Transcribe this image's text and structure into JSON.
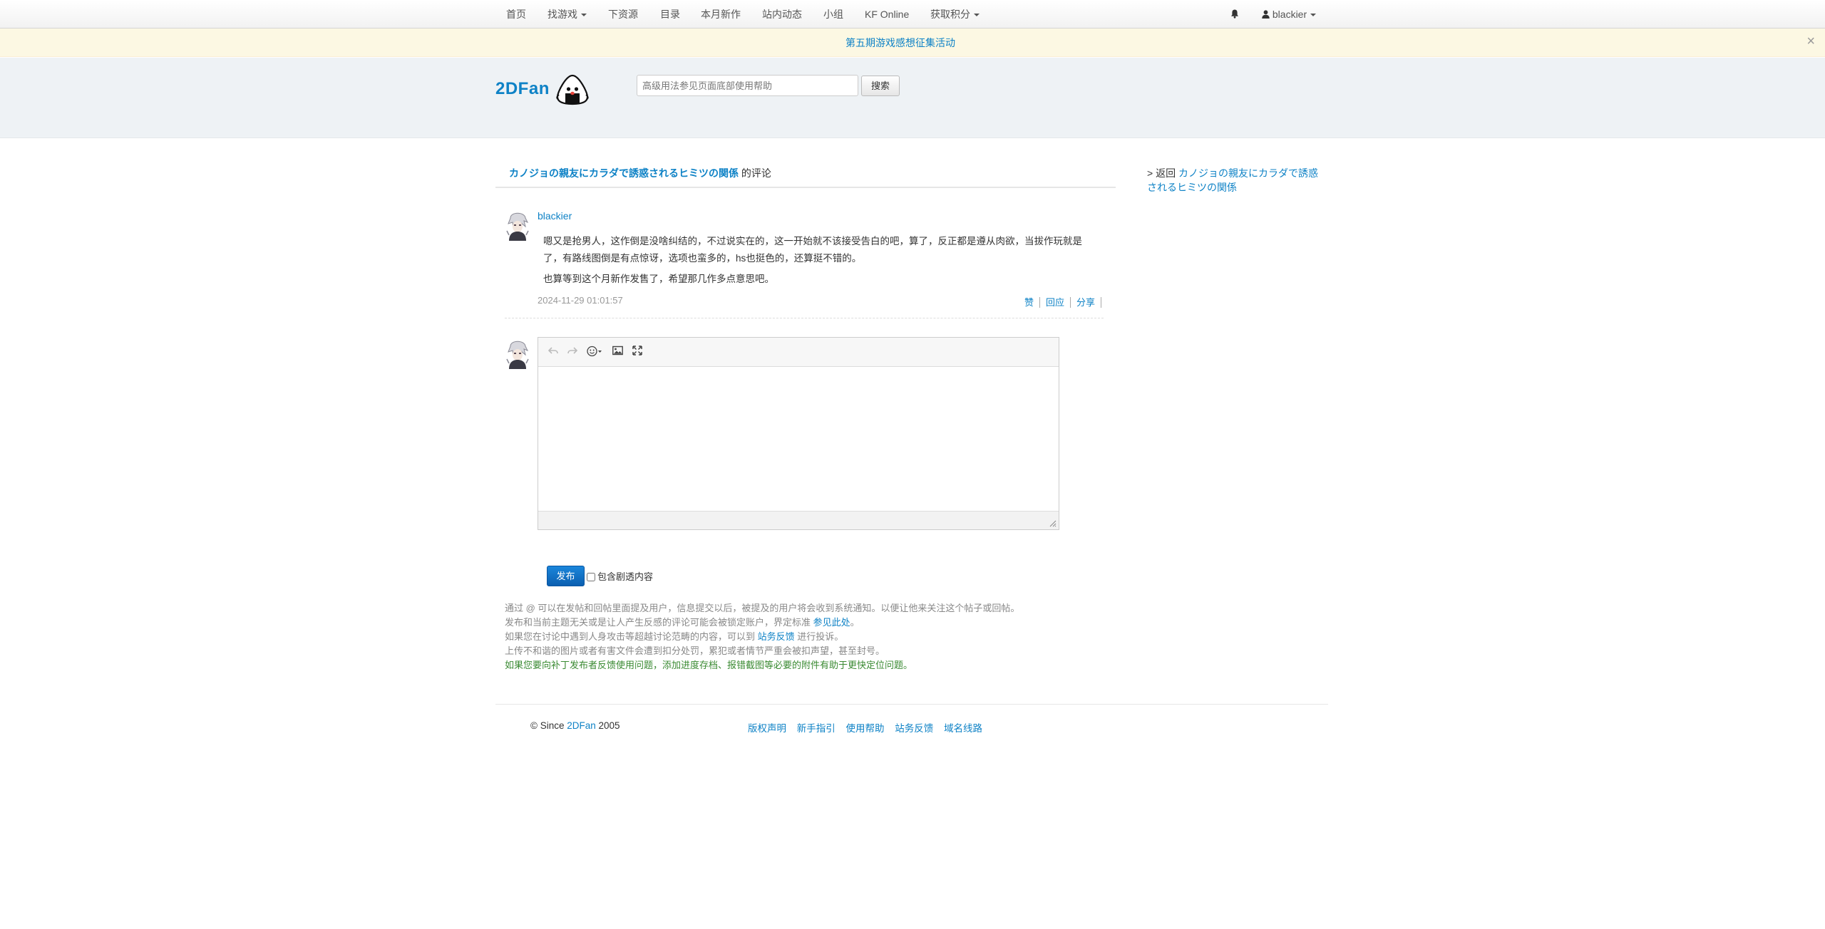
{
  "navbar": {
    "items": [
      {
        "label": "首页"
      },
      {
        "label": "找游戏"
      },
      {
        "label": "下资源"
      },
      {
        "label": "目录"
      },
      {
        "label": "本月新作"
      },
      {
        "label": "站内动态"
      },
      {
        "label": "小组"
      },
      {
        "label": "KF Online"
      },
      {
        "label": "获取积分"
      }
    ],
    "user": "blackier",
    "bell_icon": "bell-icon",
    "user_icon": "user-icon"
  },
  "announcement": {
    "text": "第五期游戏感想征集活动",
    "close": "×"
  },
  "header": {
    "logo": "2DFan",
    "search_placeholder": "高级用法参见页面底部使用帮助",
    "search_button": "搜索"
  },
  "page": {
    "title_game": "カノジョの親友にカラダで誘惑されるヒミツの関係",
    "title_suffix": " 的评论"
  },
  "comment": {
    "user": "blackier",
    "paragraphs": [
      "嗯又是抢男人，这作倒是没啥纠结的，不过说实在的，这一开始就不该接受告白的吧，算了，反正都是遵从肉欲，当拔作玩就是了，有路线图倒是有点惊讶，选项也蛮多的，hs也挺色的，还算挺不错的。",
      "也算等到这个月新作发售了，希望那几作多点意思吧。"
    ],
    "time": "2024-11-29 01:01:57",
    "actions": {
      "like": "赞",
      "reply": "回应",
      "share": "分享"
    }
  },
  "editor": {
    "icons": [
      "undo-icon",
      "redo-icon",
      "emoji-icon",
      "image-icon",
      "fullscreen-icon"
    ]
  },
  "form": {
    "publish": "发布",
    "spoiler_label": "包含剧透内容"
  },
  "notes": {
    "line1": "通过 @ 可以在发帖和回帖里面提及用户，信息提交以后，被提及的用户将会收到系统通知。以便让他来关注这个帖子或回帖。",
    "line2_pre": "发布和当前主题无关或是让人产生反感的评论可能会被锁定账户，界定标准 ",
    "line2_link": "参见此处",
    "line2_post": "。",
    "line3_pre": "如果您在讨论中遇到人身攻击等超越讨论范畴的内容，可以到 ",
    "line3_link": "站务反馈",
    "line3_post": " 进行投诉。",
    "line4": "上传不和谐的图片或者有害文件会遭到扣分处罚，累犯或者情节严重会被扣声望，甚至封号。",
    "line5": "如果您要向补丁发布者反馈使用问题，添加进度存档、报错截图等必要的附件有助于更快定位问题。"
  },
  "footer": {
    "copy_pre": "© Since ",
    "copy_link": "2DFan",
    "copy_post": " 2005",
    "links": [
      "版权声明",
      "新手指引",
      "使用帮助",
      "站务反馈",
      "域名线路"
    ]
  },
  "sidebar": {
    "back_prefix": "> 返回 ",
    "back_link": "カノジョの親友にカラダで誘惑されるヒミツの関係"
  },
  "colors": {
    "link": "#0e82c6",
    "announce_bg": "#fcf8e3",
    "header_bg": "#eef2f5",
    "publish_bg": "#0b5fb0",
    "green_note": "#3a8a32"
  }
}
